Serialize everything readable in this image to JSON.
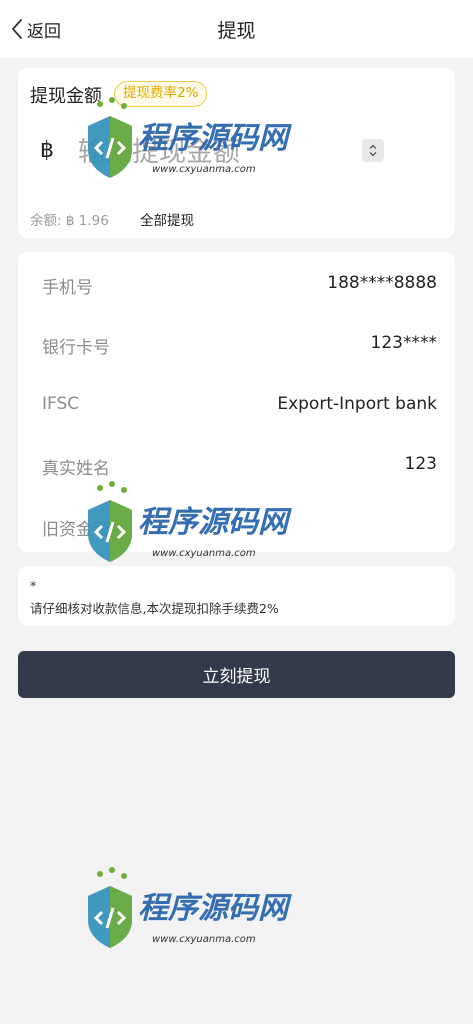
{
  "header": {
    "back_label": "返回",
    "title": "提现"
  },
  "amount": {
    "label": "提现金额",
    "fee_badge": "提现费率2%",
    "currency_symbol": "฿",
    "input_placeholder": "输入提现金额",
    "input_value": "",
    "balance_text": "余额: ฿ 1.96",
    "withdraw_all_label": "全部提现"
  },
  "info": {
    "rows": [
      {
        "label": "手机号",
        "value": "188****8888"
      },
      {
        "label": "银行卡号",
        "value": "123****"
      },
      {
        "label": "IFSC",
        "value": "Export-Inport bank"
      },
      {
        "label": "真实姓名",
        "value": "123"
      },
      {
        "label": "旧资金密码",
        "value": ""
      }
    ]
  },
  "note": {
    "asterisk": "*",
    "text": "请仔细核对收款信息,本次提现扣除手续费2%"
  },
  "submit_label": "立刻提现",
  "watermark": {
    "title": "程序源码网",
    "url": "www.cxyuanma.com"
  },
  "colors": {
    "accent": "#333a4b",
    "badge": "#f2c94c",
    "background": "#f3f3f3"
  }
}
